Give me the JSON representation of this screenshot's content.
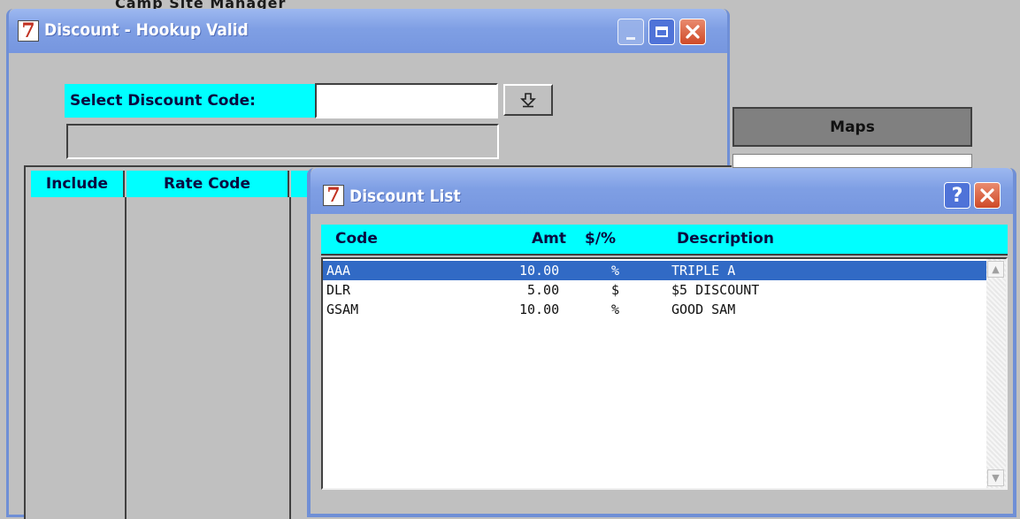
{
  "background": {
    "top_text": "Camp Site Manager",
    "maps_tab_label": "Maps"
  },
  "main_window": {
    "logo": "7",
    "title": "Discount - Hookup Valid",
    "select_label": "Select Discount Code:",
    "select_value": "",
    "lookup_icon": "down-arrow-icon",
    "status_value": "",
    "grid_headers": [
      "Include",
      "Rate Code"
    ]
  },
  "list_window": {
    "logo": "7",
    "title": "Discount List",
    "help_label": "?",
    "columns": {
      "code": "Code",
      "amt": "Amt",
      "type": "$/%",
      "description": "Description"
    },
    "rows": [
      {
        "code": "AAA",
        "amt": "10.00",
        "type": "%",
        "description": "TRIPLE A",
        "selected": true
      },
      {
        "code": "DLR",
        "amt": "5.00",
        "type": "$",
        "description": "$5 DISCOUNT",
        "selected": false
      },
      {
        "code": "GSAM",
        "amt": "10.00",
        "type": "%",
        "description": "GOOD SAM",
        "selected": false
      }
    ]
  },
  "colors": {
    "header_cyan": "#00ffff",
    "selection_blue": "#316ac5",
    "titlebar_blue": "#7f9fe4",
    "close_red": "#cf4a28"
  }
}
